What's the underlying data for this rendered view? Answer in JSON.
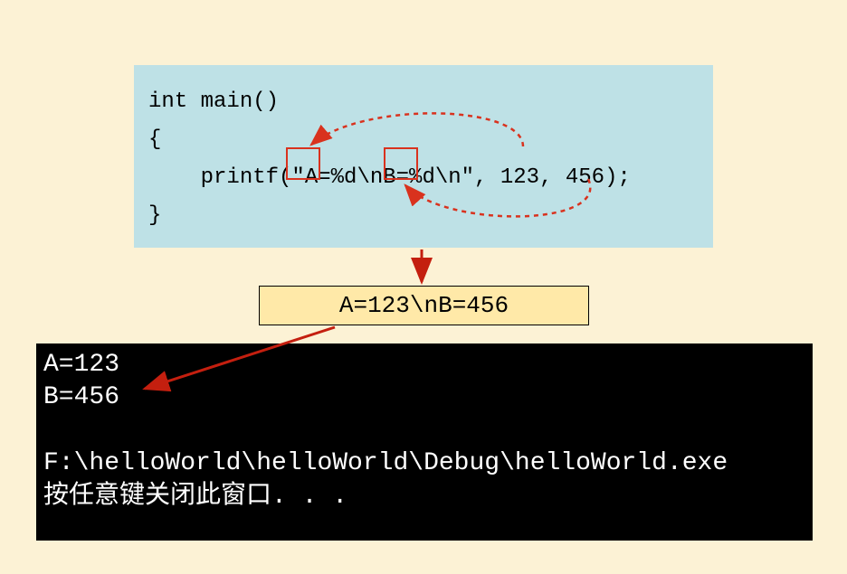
{
  "code": {
    "line1": "int main()",
    "line2": "{",
    "line3": "    printf(\"A=%d\\nB=%d\\n\", 123, 456);",
    "line4": "}"
  },
  "format_specifiers": {
    "first": "%d",
    "second": "%d",
    "arg1": "123",
    "arg2": "456"
  },
  "result_string": "A=123\\nB=456",
  "terminal": {
    "line1": "A=123",
    "line2": "B=456",
    "line3": "",
    "line4": "F:\\helloWorld\\helloWorld\\Debug\\helloWorld.exe",
    "line5": "按任意键关闭此窗口. . ."
  }
}
